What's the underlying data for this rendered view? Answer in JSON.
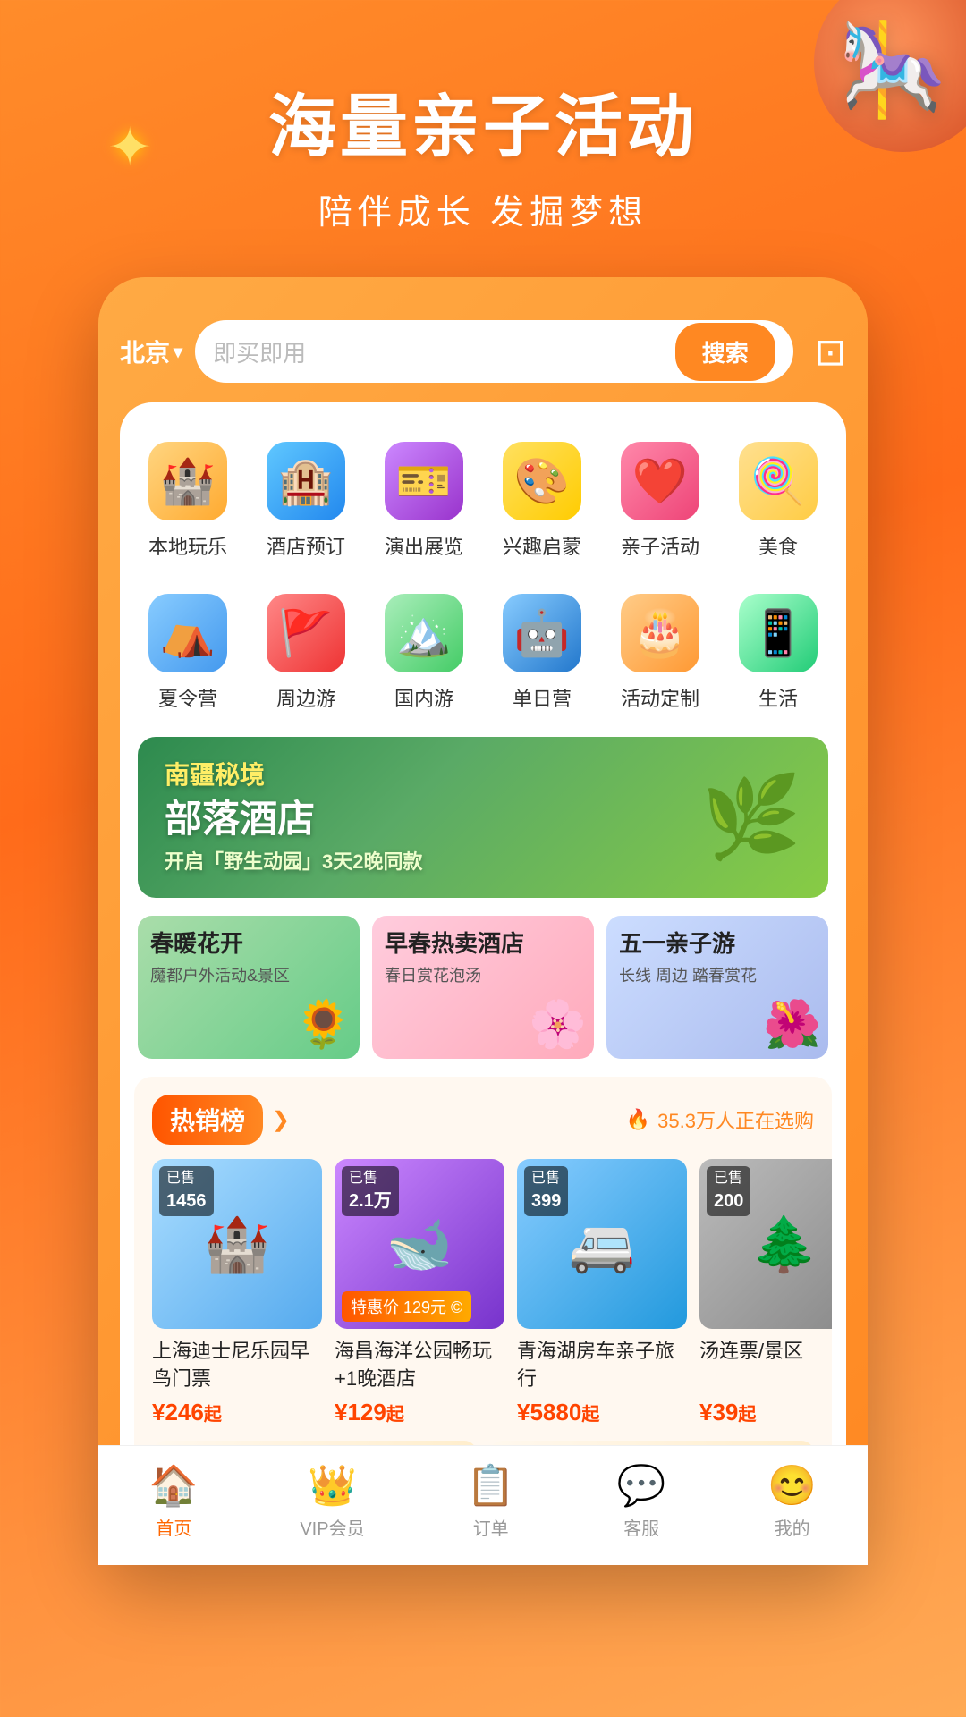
{
  "hero": {
    "title": "海量亲子活动",
    "subtitle": "陪伴成长 发掘梦想"
  },
  "search": {
    "location": "北京",
    "placeholder": "即买即用",
    "button_label": "搜索"
  },
  "categories_row1": [
    {
      "id": "local-fun",
      "label": "本地玩乐",
      "emoji": "🏰",
      "bg": "cat-1"
    },
    {
      "id": "hotel-booking",
      "label": "酒店预订",
      "emoji": "🏨",
      "bg": "cat-2"
    },
    {
      "id": "show-exhibit",
      "label": "演出展览",
      "emoji": "🎫",
      "bg": "cat-3"
    },
    {
      "id": "interest-enlighten",
      "label": "兴趣启蒙",
      "emoji": "🎨",
      "bg": "cat-4"
    },
    {
      "id": "parent-child",
      "label": "亲子活动",
      "emoji": "❤️",
      "bg": "cat-5"
    },
    {
      "id": "food",
      "label": "美食",
      "emoji": "🍭",
      "bg": "cat-6"
    }
  ],
  "categories_row2": [
    {
      "id": "summer-camp",
      "label": "夏令营",
      "emoji": "⛺",
      "bg": "cat-7"
    },
    {
      "id": "nearby-tour",
      "label": "周边游",
      "emoji": "🚩",
      "bg": "cat-8"
    },
    {
      "id": "domestic-tour",
      "label": "国内游",
      "emoji": "🏔️",
      "bg": "cat-9"
    },
    {
      "id": "day-camp",
      "label": "单日营",
      "emoji": "🤖",
      "bg": "cat-10"
    },
    {
      "id": "activity-custom",
      "label": "活动定制",
      "emoji": "🎂",
      "bg": "cat-11"
    },
    {
      "id": "life",
      "label": "生活",
      "emoji": "📱",
      "bg": "cat-12"
    }
  ],
  "banner": {
    "main_text": "部落酒店",
    "sub_text": "开启「野生动园」3天2晚同款"
  },
  "mini_banners": [
    {
      "id": "spring-flowers",
      "title": "春暖花开",
      "sub": "魔都户外活动&景区",
      "emoji": "🌻"
    },
    {
      "id": "hot-hotel",
      "title": "早春热卖酒店",
      "sub": "春日赏花泡汤",
      "emoji": "🌸"
    },
    {
      "id": "may-day",
      "title": "五一亲子游",
      "sub": "长线 周边 踏春赏花",
      "emoji": "🌺"
    }
  ],
  "hot_sales": {
    "badge": "热销榜",
    "user_count": "35.3万人正在选购",
    "products": [
      {
        "id": "disney",
        "sold_label": "已售",
        "sold_count": "1456",
        "name": "上海迪士尼乐园早鸟门票",
        "price": "¥246",
        "price_unit": "起",
        "emoji": "🏰",
        "bg": "product-img-bg-1"
      },
      {
        "id": "haichang",
        "sold_label": "已售",
        "sold_count": "2.1万",
        "name": "海昌海洋公园畅玩+1晚酒店",
        "price": "¥129",
        "price_unit": "起",
        "special_price": "特惠价 129元",
        "emoji": "🐋",
        "bg": "product-img-bg-2"
      },
      {
        "id": "qinghai",
        "sold_label": "已售",
        "sold_count": "399",
        "name": "青海湖房车亲子旅行",
        "price": "¥5880",
        "price_unit": "起",
        "emoji": "🚐",
        "bg": "product-img-bg-3"
      },
      {
        "id": "soup-connected",
        "sold_label": "已售",
        "sold_count": "200",
        "name": "汤连票/景区",
        "price": "¥39",
        "price_unit": "起",
        "emoji": "🌲",
        "bg": "product-img-bg-4"
      }
    ]
  },
  "bottom_nav": [
    {
      "id": "home",
      "label": "首页",
      "emoji": "🏠",
      "active": true
    },
    {
      "id": "vip",
      "label": "VIP会员",
      "emoji": "👑",
      "active": false
    },
    {
      "id": "orders",
      "label": "订单",
      "emoji": "📋",
      "active": false
    },
    {
      "id": "service",
      "label": "客服",
      "emoji": "💬",
      "active": false
    },
    {
      "id": "my",
      "label": "我的",
      "emoji": "😊",
      "active": false
    }
  ]
}
